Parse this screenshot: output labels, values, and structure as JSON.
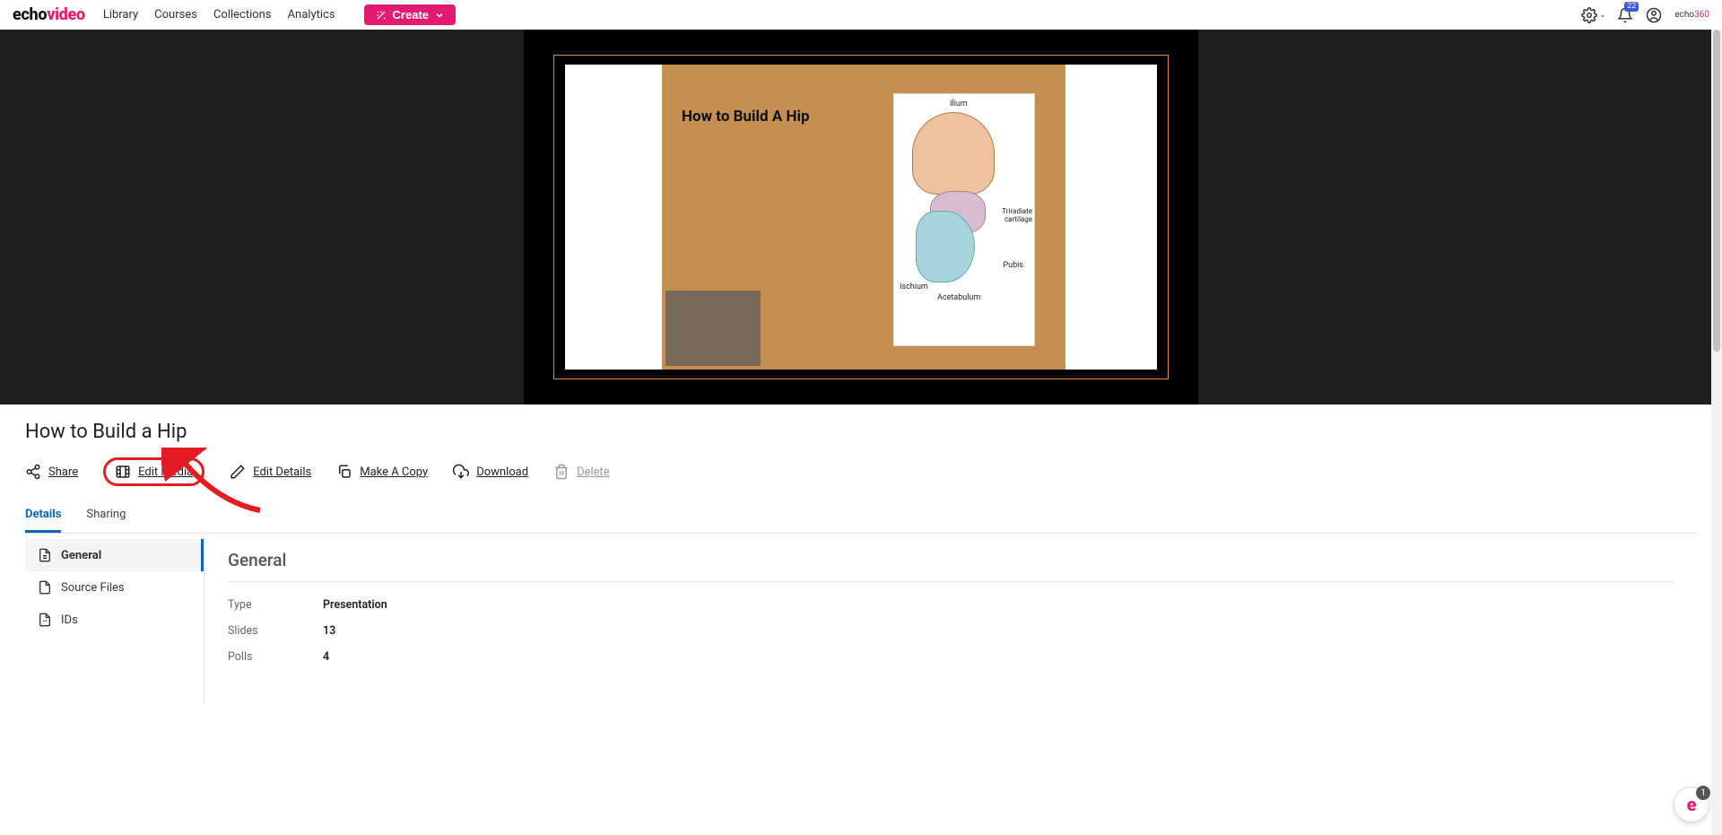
{
  "brand": {
    "part1": "echo",
    "part2": "video",
    "small_part1": "echo",
    "small_part2": "360"
  },
  "nav": {
    "library": "Library",
    "courses": "Courses",
    "collections": "Collections",
    "analytics": "Analytics",
    "create": "Create"
  },
  "notifications": {
    "count": "22"
  },
  "slide": {
    "title": "How to Build A Hip",
    "labels": {
      "ilium": "Ilium",
      "triradiate": "Triradiate\ncartilage",
      "pubis": "Pubis",
      "ischium": "Ischium",
      "acetabulum": "Acetabulum"
    }
  },
  "media": {
    "title": "How to Build a Hip"
  },
  "actions": {
    "share": "Share",
    "edit_media": "Edit Media",
    "edit_details": "Edit Details",
    "make_copy": "Make A Copy",
    "download": "Download",
    "delete": "Delete"
  },
  "tabs": {
    "details": "Details",
    "sharing": "Sharing"
  },
  "sidebar": {
    "general": "General",
    "source_files": "Source Files",
    "ids": "IDs"
  },
  "section": {
    "title": "General"
  },
  "details": {
    "type_label": "Type",
    "type_value": "Presentation",
    "slides_label": "Slides",
    "slides_value": "13",
    "polls_label": "Polls",
    "polls_value": "4"
  },
  "help": {
    "letter": "e",
    "count": "1"
  }
}
